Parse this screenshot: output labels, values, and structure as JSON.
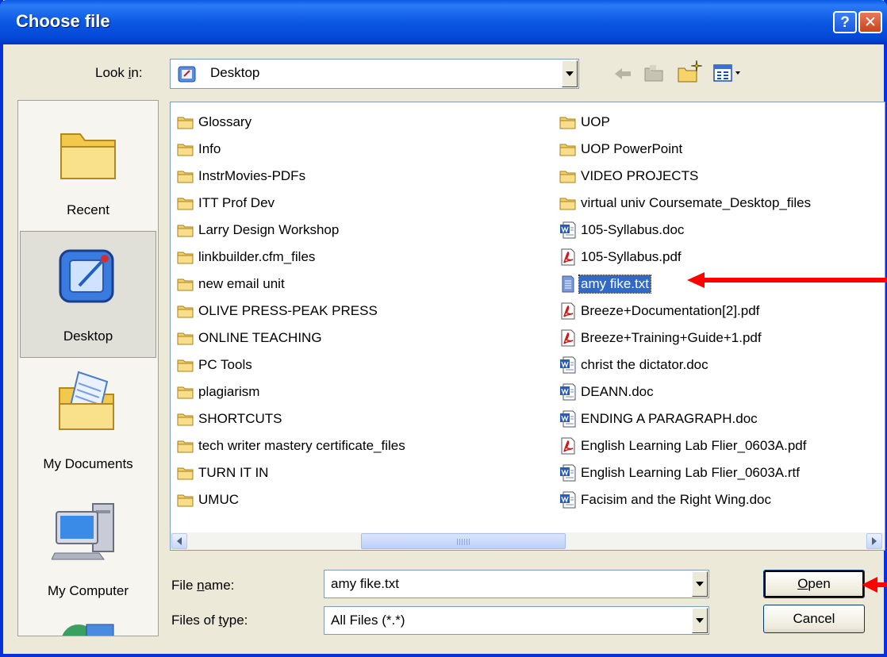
{
  "window": {
    "title": "Choose file",
    "help_glyph": "?",
    "close_glyph": "✕"
  },
  "look_in": {
    "label_pre": "Look ",
    "label_hot": "i",
    "label_post": "n:",
    "value": "Desktop"
  },
  "places": [
    {
      "label": "Recent",
      "icon": "recent-folder-icon"
    },
    {
      "label": "Desktop",
      "icon": "desktop-icon",
      "selected": true
    },
    {
      "label": "My Documents",
      "icon": "my-documents-icon"
    },
    {
      "label": "My Computer",
      "icon": "my-computer-icon"
    }
  ],
  "files_left": [
    {
      "name": "Glossary",
      "type": "folder"
    },
    {
      "name": "Info",
      "type": "folder"
    },
    {
      "name": "InstrMovies-PDFs",
      "type": "folder"
    },
    {
      "name": "ITT Prof Dev",
      "type": "folder"
    },
    {
      "name": "Larry Design Workshop",
      "type": "folder"
    },
    {
      "name": "linkbuilder.cfm_files",
      "type": "folder"
    },
    {
      "name": "new email unit",
      "type": "folder"
    },
    {
      "name": "OLIVE PRESS-PEAK PRESS",
      "type": "folder"
    },
    {
      "name": "ONLINE TEACHING",
      "type": "folder"
    },
    {
      "name": "PC Tools",
      "type": "folder"
    },
    {
      "name": "plagiarism",
      "type": "folder"
    },
    {
      "name": "SHORTCUTS",
      "type": "folder"
    },
    {
      "name": "tech writer mastery certificate_files",
      "type": "folder"
    },
    {
      "name": "TURN IT IN",
      "type": "folder"
    },
    {
      "name": "UMUC",
      "type": "folder"
    }
  ],
  "files_right": [
    {
      "name": "UOP",
      "type": "folder"
    },
    {
      "name": "UOP PowerPoint",
      "type": "folder"
    },
    {
      "name": "VIDEO PROJECTS",
      "type": "folder"
    },
    {
      "name": "virtual univ Coursemate_Desktop_files",
      "type": "folder"
    },
    {
      "name": "105-Syllabus.doc",
      "type": "doc"
    },
    {
      "name": "105-Syllabus.pdf",
      "type": "pdf"
    },
    {
      "name": "amy fike.txt",
      "type": "txt",
      "selected": true
    },
    {
      "name": "Breeze+Documentation[2].pdf",
      "type": "pdf"
    },
    {
      "name": "Breeze+Training+Guide+1.pdf",
      "type": "pdf"
    },
    {
      "name": "christ the dictator.doc",
      "type": "doc"
    },
    {
      "name": "DEANN.doc",
      "type": "doc"
    },
    {
      "name": "ENDING A PARAGRAPH.doc",
      "type": "doc"
    },
    {
      "name": "English Learning Lab Flier_0603A.pdf",
      "type": "pdf"
    },
    {
      "name": "English Learning Lab Flier_0603A.rtf",
      "type": "doc"
    },
    {
      "name": "Facisim and the Right Wing.doc",
      "type": "doc"
    }
  ],
  "file_name": {
    "label_pre": "File ",
    "label_hot": "n",
    "label_post": "ame:",
    "value": "amy fike.txt"
  },
  "file_type": {
    "label_pre": "Files of ",
    "label_hot": "t",
    "label_post": "ype:",
    "value": "All Files (*.*)"
  },
  "buttons": {
    "open_hot": "O",
    "open_rest": "pen",
    "cancel": "Cancel"
  },
  "colors": {
    "selection": "#316ac5",
    "annotation_arrow": "#ff0000",
    "titlebar": "#0a5ae8"
  }
}
